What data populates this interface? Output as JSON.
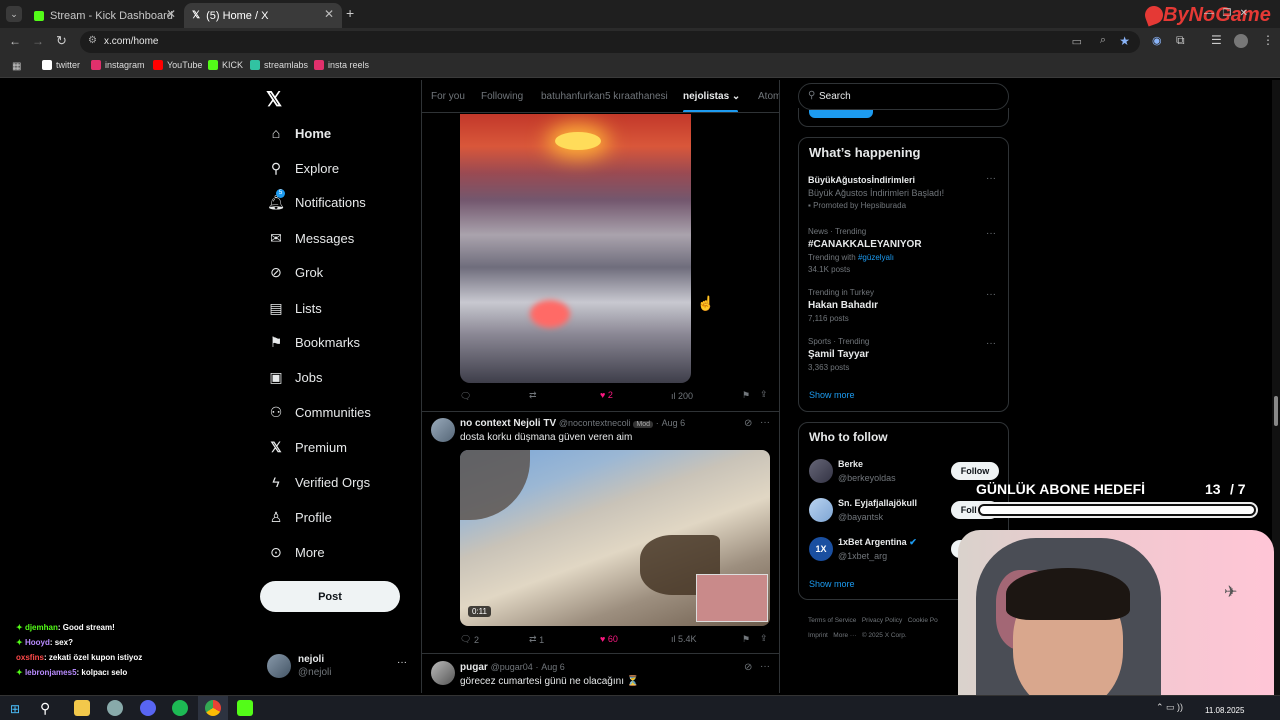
{
  "browser": {
    "tabs": [
      {
        "title": "Stream - Kick Dashboard",
        "active": false
      },
      {
        "title": "(5) Home / X",
        "active": true
      }
    ],
    "new_tab": "+",
    "url": "x.com/home",
    "bookmarks": [
      "twitter",
      "instagram",
      "YouTube",
      "KICK",
      "streamlabs",
      "insta reels"
    ]
  },
  "watermark": "ByNoGame",
  "nav": {
    "items": [
      "Home",
      "Explore",
      "Notifications",
      "Messages",
      "Grok",
      "Lists",
      "Bookmarks",
      "Jobs",
      "Communities",
      "Premium",
      "Verified Orgs",
      "Profile",
      "More"
    ],
    "notifications_badge": "5",
    "post_button": "Post",
    "account": {
      "name": "nejoli",
      "handle": "@nejoli"
    }
  },
  "feed": {
    "tabs": [
      "For you",
      "Following",
      "batuhanfurkan5 kıraathanesi",
      "nejolistas",
      "Atom"
    ],
    "active_tab": "nejolistas",
    "post1_actions": {
      "likes": "2",
      "views": "200"
    },
    "post2": {
      "author": "no context Nejoli TV",
      "handle": "@nocontextnecoli",
      "badge": "Mod",
      "date": "Aug 6",
      "text": "dosta korku düşmana güven veren aim",
      "video_time": "0:11",
      "replies": "2",
      "reposts": "1",
      "likes": "60",
      "views": "5.4K"
    },
    "post3": {
      "author": "pugar",
      "handle": "@pugar04",
      "date": "Aug 6",
      "text": "görecez cumartesi günü ne olacağını ⏳"
    }
  },
  "sidebar_right": {
    "search_placeholder": "Search",
    "whats_happening": "What’s happening",
    "trends": [
      {
        "context": "BüyükAğustosİndirimleri",
        "title": "Büyük Ağustos İndirimleri Başladı!",
        "meta": "Promoted by Hepsiburada"
      },
      {
        "context": "News · Trending",
        "title": "#CANAKKALEYANIYOR",
        "meta": "Trending with",
        "tag": "#güzelyalı",
        "posts": "34.1K posts"
      },
      {
        "context": "Trending in Turkey",
        "title": "Hakan Bahadır",
        "posts": "7,116 posts"
      },
      {
        "context": "Sports · Trending",
        "title": "Şamil Tayyar",
        "posts": "3,363 posts"
      }
    ],
    "show_more": "Show more",
    "who_to_follow": "Who to follow",
    "follow_label": "Follow",
    "suggestions": [
      {
        "name": "Berke",
        "handle": "@berkeyoldas"
      },
      {
        "name": "Sn. Eyjafjallajökull",
        "handle": "@bayantsk"
      },
      {
        "name": "1xBet Argentina",
        "handle": "@1xbet_arg"
      }
    ],
    "footer": [
      "Terms of Service",
      "Privacy Policy",
      "Cookie Po",
      "Imprint",
      "More ···",
      "© 2025 X Corp."
    ]
  },
  "overlay": {
    "goal_label": "GÜNLÜK ABONE HEDEFİ",
    "goal_current": "13",
    "goal_total": "/ 7",
    "goal_progress": 1.0
  },
  "chat": [
    {
      "user": "djemhan",
      "msg": ": Good stream!",
      "color": "#53fc18"
    },
    {
      "user": "Hooyd",
      "msg": ": sex?",
      "color": "#b98cff"
    },
    {
      "user": "oxsfins",
      "msg": ": zekati özel kupon istiyoz",
      "color": "#ff4a4a"
    },
    {
      "user": "lebronjames5",
      "msg": ": kolpacı selo",
      "color": "#b98cff"
    }
  ],
  "taskbar": {
    "date": "11.08.2025"
  }
}
